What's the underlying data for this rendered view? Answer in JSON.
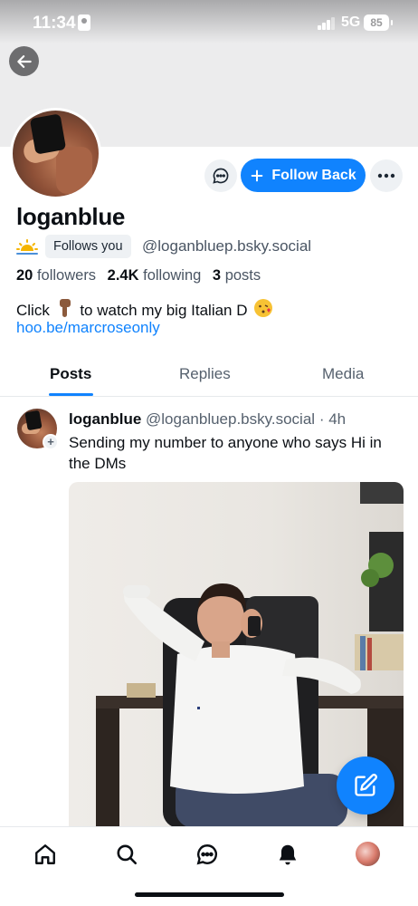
{
  "status_bar": {
    "time": "11:34",
    "network": "5G",
    "battery": "85"
  },
  "profile": {
    "display_name": "loganblue",
    "follows_you_label": "Follows you",
    "handle": "@loganbluep.bsky.social",
    "stats": {
      "followers_count": "20",
      "followers_label": "followers",
      "following_count": "2.4K",
      "following_label": "following",
      "posts_count": "3",
      "posts_label": "posts"
    },
    "bio": {
      "part1": "Click",
      "part2": "to watch my big Italian D",
      "link": "hoo.be/marcroseonly"
    },
    "actions": {
      "follow_label": "Follow Back"
    }
  },
  "tabs": [
    {
      "label": "Posts",
      "active": true
    },
    {
      "label": "Replies",
      "active": false
    },
    {
      "label": "Media",
      "active": false
    }
  ],
  "post": {
    "author": "loganblue",
    "handle": "@loganbluep.bsky.social",
    "separator": "·",
    "time": "4h",
    "text": "Sending my number to anyone who says Hi in the DMs"
  },
  "colors": {
    "accent": "#1083fe",
    "text": "#0b0f14",
    "muted": "#56616e"
  },
  "icons": {
    "back": "arrow-left-icon",
    "message": "chat-bubble-icon",
    "more": "ellipsis-icon",
    "compose": "pencil-square-icon",
    "nav": [
      "home-icon",
      "search-icon",
      "chat-icon",
      "bell-icon"
    ]
  }
}
